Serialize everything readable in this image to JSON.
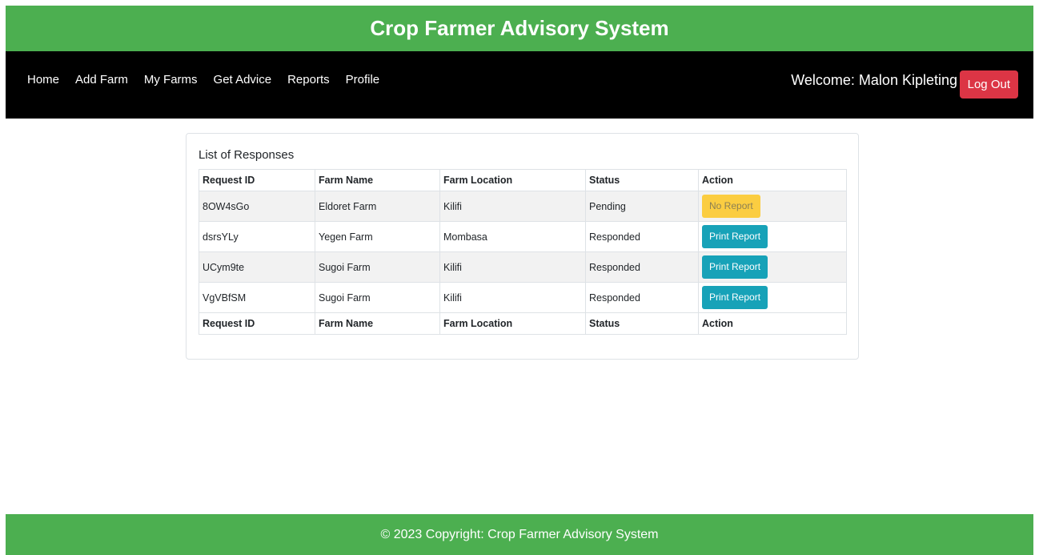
{
  "header": {
    "title": "Crop Farmer Advisory System"
  },
  "nav": {
    "links": [
      "Home",
      "Add Farm",
      "My Farms",
      "Get Advice",
      "Reports",
      "Profile"
    ],
    "welcome": "Welcome: Malon Kipleting",
    "logout_label": "Log Out"
  },
  "card": {
    "title": "List of Responses",
    "columns": [
      "Request ID",
      "Farm Name",
      "Farm Location",
      "Status",
      "Action"
    ],
    "rows": [
      {
        "request_id": "8OW4sGo",
        "farm_name": "Eldoret Farm",
        "farm_location": "Kilifi",
        "status": "Pending",
        "action": "No Report",
        "action_type": "warning"
      },
      {
        "request_id": "dsrsYLy",
        "farm_name": "Yegen Farm",
        "farm_location": "Mombasa",
        "status": "Responded",
        "action": "Print Report",
        "action_type": "info"
      },
      {
        "request_id": "UCym9te",
        "farm_name": "Sugoi Farm",
        "farm_location": "Kilifi",
        "status": "Responded",
        "action": "Print Report",
        "action_type": "info"
      },
      {
        "request_id": "VgVBfSM",
        "farm_name": "Sugoi Farm",
        "farm_location": "Kilifi",
        "status": "Responded",
        "action": "Print Report",
        "action_type": "info"
      }
    ]
  },
  "footer": {
    "text": "© 2023 Copyright: Crop Farmer Advisory System"
  },
  "colors": {
    "header_green": "#4caf50",
    "nav_black": "#000000",
    "logout_red": "#dc3545",
    "warning_yellow": "#ffc107",
    "info_teal": "#17a2b8"
  }
}
